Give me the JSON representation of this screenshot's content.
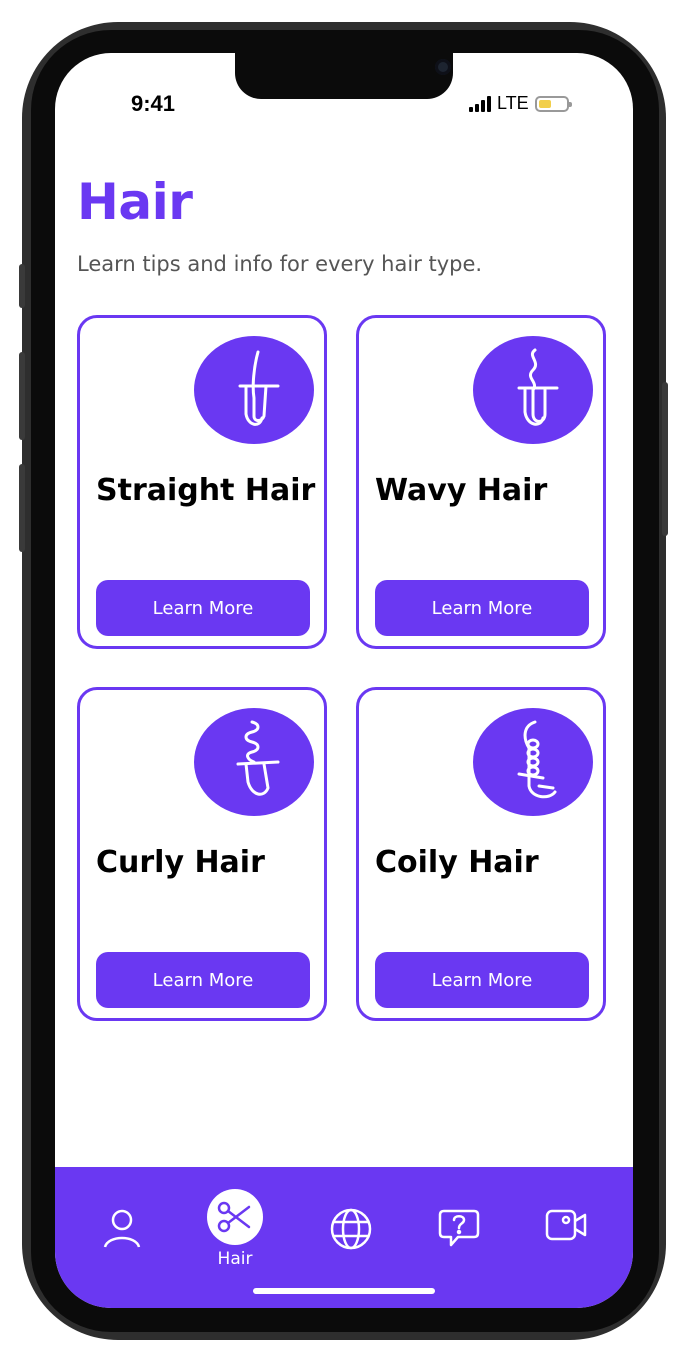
{
  "status_bar": {
    "time": "9:41",
    "network": "LTE"
  },
  "page": {
    "title": "Hair",
    "subtitle": "Learn tips and info for every hair type."
  },
  "cards": [
    {
      "title": "Straight Hair",
      "button": "Learn More",
      "icon": "straight-hair-icon"
    },
    {
      "title": "Wavy Hair",
      "button": "Learn More",
      "icon": "wavy-hair-icon"
    },
    {
      "title": "Curly Hair",
      "button": "Learn More",
      "icon": "curly-hair-icon"
    },
    {
      "title": "Coily Hair",
      "button": "Learn More",
      "icon": "coily-hair-icon"
    }
  ],
  "tab_bar": {
    "active_label": "Hair",
    "tabs": [
      {
        "icon": "person-icon"
      },
      {
        "icon": "scissors-icon",
        "label": "Hair"
      },
      {
        "icon": "globe-icon"
      },
      {
        "icon": "question-chat-icon"
      },
      {
        "icon": "video-camera-icon"
      }
    ]
  },
  "colors": {
    "accent": "#6a38f2",
    "battery": "#f2cf4a"
  }
}
